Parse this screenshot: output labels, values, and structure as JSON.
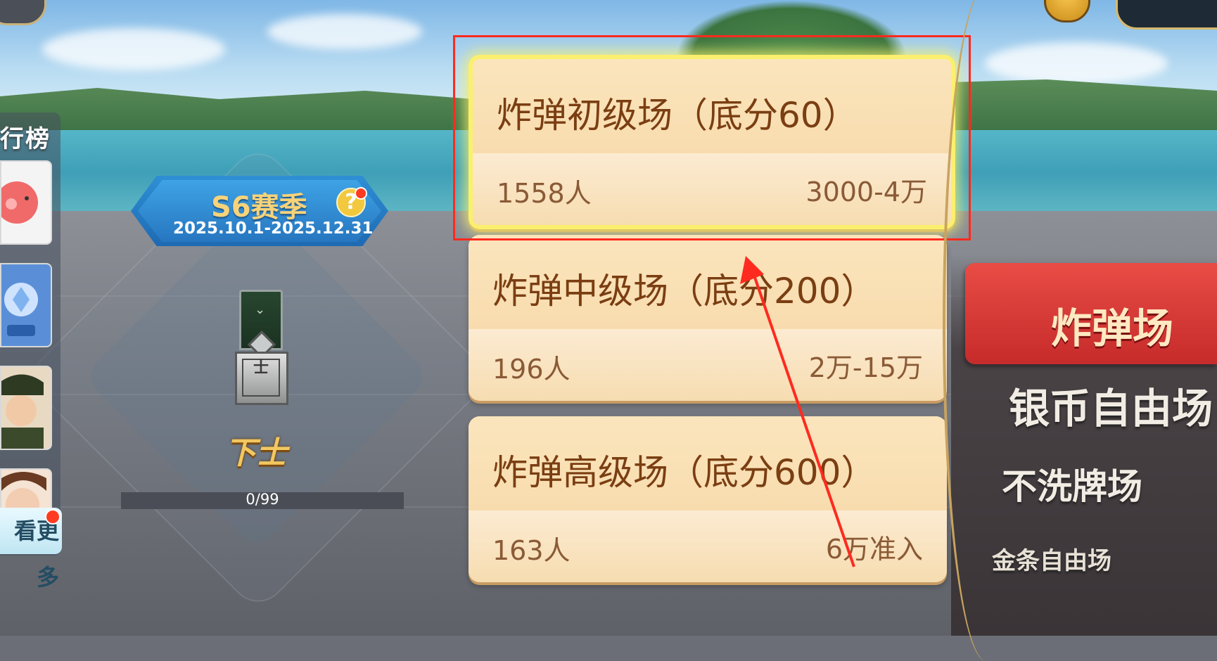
{
  "left_panel": {
    "ranking_label": "行榜",
    "more_label": "看更多"
  },
  "season": {
    "name": "S6赛季",
    "dates": "2025.10.1-2025.12.31",
    "help_icon": "?"
  },
  "rank": {
    "medal_text": "士",
    "name": "下士",
    "progress_text": "0/99",
    "progress_fraction": 0
  },
  "rooms": [
    {
      "title": "炸弹初级场（底分60）",
      "players": "1558人",
      "range": "3000-4万",
      "selected": true
    },
    {
      "title": "炸弹中级场（底分200）",
      "players": "196人",
      "range": "2万-15万",
      "selected": false
    },
    {
      "title": "炸弹高级场（底分600）",
      "players": "163人",
      "range": "6万准入",
      "selected": false
    }
  ],
  "right_menu": {
    "active": "炸弹场",
    "items": [
      "银币自由场",
      "不洗牌场",
      "金条自由场"
    ]
  },
  "colors": {
    "annotation": "#ff2a1f",
    "active_tab": "#d9383a",
    "card": "#f8dcae"
  }
}
